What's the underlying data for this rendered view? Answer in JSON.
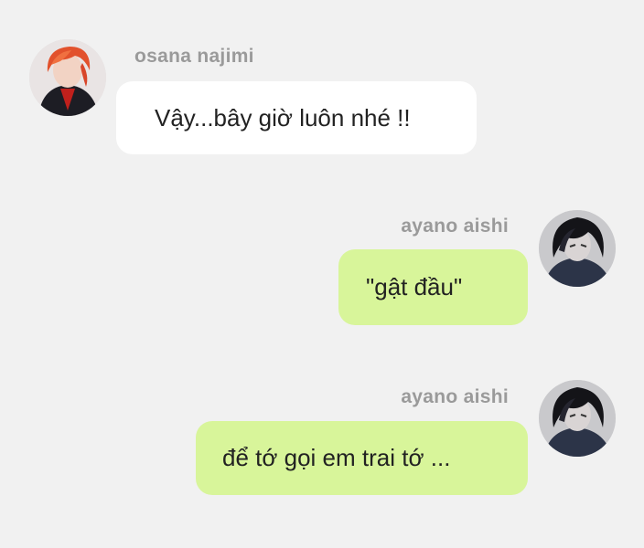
{
  "messages": [
    {
      "sender": "osana najimi",
      "text": "Vậy...bây giờ luôn nhé !!",
      "side": "incoming",
      "avatar_icon": "red-haired-avatar-icon"
    },
    {
      "sender": "ayano aishi",
      "text": "\"gật đầu\"",
      "side": "outgoing",
      "avatar_icon": "dark-haired-avatar-icon"
    },
    {
      "sender": "ayano aishi",
      "text": "để tớ gọi em trai tớ ...",
      "side": "outgoing",
      "avatar_icon": "dark-haired-avatar-icon"
    }
  ],
  "colors": {
    "background": "#f1f1f1",
    "incoming_bubble": "#ffffff",
    "outgoing_bubble": "#d8f59a",
    "sender_name": "#9a9a9a",
    "message_text": "#222222"
  }
}
